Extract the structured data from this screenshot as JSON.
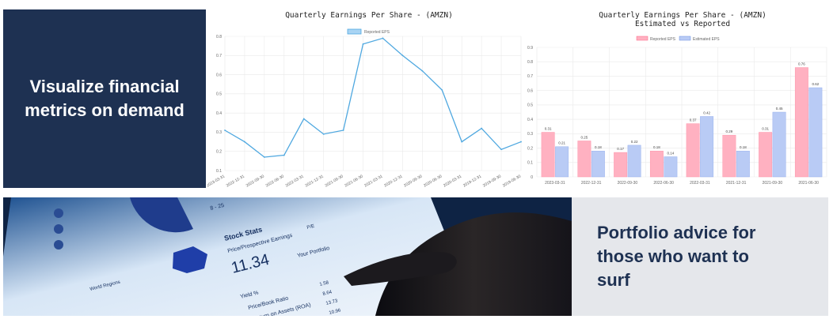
{
  "hero_left": {
    "headline_line1": "Visualize financial",
    "headline_line2": "metrics on demand"
  },
  "hero_right": {
    "headline_line1": "Portfolio advice for",
    "headline_line2": "those who want to",
    "headline_line3": "surf"
  },
  "colors": {
    "navy": "#1e3152",
    "grey": "#e5e7eb",
    "line": "#4fa8e0",
    "pink": "#ffb1c1",
    "blue": "#b9cbf5"
  },
  "chart_data": [
    {
      "type": "line",
      "title": "Quarterly Earnings Per Share - (AMZN)",
      "legend": [
        "Reported EPS"
      ],
      "ylim": [
        0.1,
        0.8
      ],
      "yticks": [
        "0.1",
        "0.2",
        "0.3",
        "0.4",
        "0.5",
        "0.6",
        "0.7",
        "0.8"
      ],
      "x": [
        "2023-03-31",
        "2022-12-31",
        "2022-09-30",
        "2022-06-30",
        "2022-03-31",
        "2021-12-31",
        "2021-09-30",
        "2021-06-30",
        "2021-03-31",
        "2020-12-31",
        "2020-09-30",
        "2020-06-30",
        "2020-03-31",
        "2019-12-31",
        "2019-09-30",
        "2019-06-30"
      ],
      "series": [
        {
          "name": "Reported EPS",
          "values": [
            0.31,
            0.25,
            0.17,
            0.18,
            0.37,
            0.29,
            0.31,
            0.76,
            0.79,
            0.7,
            0.62,
            0.52,
            0.25,
            0.32,
            0.21,
            0.25
          ]
        }
      ]
    },
    {
      "type": "bar",
      "title": "Quarterly Earnings Per Share - (AMZN)",
      "subtitle": "Estimated vs Reported",
      "legend": [
        "Reported EPS",
        "Estimated EPS"
      ],
      "ylim": [
        0,
        0.9
      ],
      "yticks": [
        "0",
        "0.1",
        "0.2",
        "0.3",
        "0.4",
        "0.5",
        "0.6",
        "0.7",
        "0.8",
        "0.9"
      ],
      "categories": [
        "2023-03-31",
        "2022-12-31",
        "2022-09-30",
        "2022-06-30",
        "2022-03-31",
        "2021-12-31",
        "2021-09-30",
        "2021-06-30"
      ],
      "series": [
        {
          "name": "Reported EPS",
          "values": [
            0.31,
            0.25,
            0.17,
            0.18,
            0.37,
            0.29,
            0.31,
            0.76
          ]
        },
        {
          "name": "Estimated EPS",
          "values": [
            0.21,
            0.18,
            0.22,
            0.14,
            0.42,
            0.18,
            0.45,
            0.62
          ]
        }
      ],
      "labels": [
        [
          "0.31",
          "0.25",
          "0.17",
          "0.18",
          "0.37",
          "0.29",
          "0.31",
          "0.76"
        ],
        [
          "0.21",
          "0.18",
          "0.22",
          "0.14",
          "0.42",
          "0.18",
          "0.45",
          "0.62"
        ]
      ]
    }
  ],
  "photo": {
    "stat_title": "Stock Stats",
    "stat_label": "Price/Prospective Earnings",
    "stat_value": "11.34",
    "your_portfolio": "Your Portfolio",
    "pe": "P/E",
    "range": "8 - 25",
    "yield": "Yield %",
    "pb": "Price/Book Ratio",
    "roa": "Return on Assets (ROA)",
    "world_regions": "World Regions",
    "nums": [
      "1.58",
      "8.64",
      "13.73",
      "10.96"
    ]
  }
}
